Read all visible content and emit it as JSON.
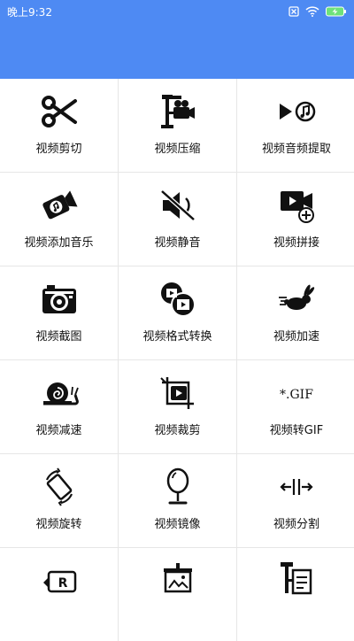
{
  "status_bar": {
    "time": "晚上9:32",
    "battery_color": "#6ee27a"
  },
  "header": {
    "color": "#4e8af3"
  },
  "tools": [
    {
      "label": "视频剪切",
      "icon": "scissors-icon"
    },
    {
      "label": "视频压缩",
      "icon": "clamp-camera-icon"
    },
    {
      "label": "视频音频提取",
      "icon": "play-music-icon"
    },
    {
      "label": "视频添加音乐",
      "icon": "camera-music-icon"
    },
    {
      "label": "视频静音",
      "icon": "mute-icon"
    },
    {
      "label": "视频拼接",
      "icon": "video-add-icon"
    },
    {
      "label": "视频截图",
      "icon": "camera-icon"
    },
    {
      "label": "视频格式转换",
      "icon": "convert-format-icon"
    },
    {
      "label": "视频加速",
      "icon": "rabbit-icon"
    },
    {
      "label": "视频减速",
      "icon": "snail-icon"
    },
    {
      "label": "视频裁剪",
      "icon": "crop-video-icon"
    },
    {
      "label": "视频转GIF",
      "icon": "gif-icon",
      "icon_text": "*.GIF"
    },
    {
      "label": "视频旋转",
      "icon": "rotate-icon"
    },
    {
      "label": "视频镜像",
      "icon": "mirror-icon"
    },
    {
      "label": "视频分割",
      "icon": "split-icon"
    },
    {
      "label": "",
      "icon": "reverse-icon",
      "icon_text": "R"
    },
    {
      "label": "",
      "icon": "presentation-icon"
    },
    {
      "label": "",
      "icon": "mp3-clamp-icon"
    }
  ]
}
